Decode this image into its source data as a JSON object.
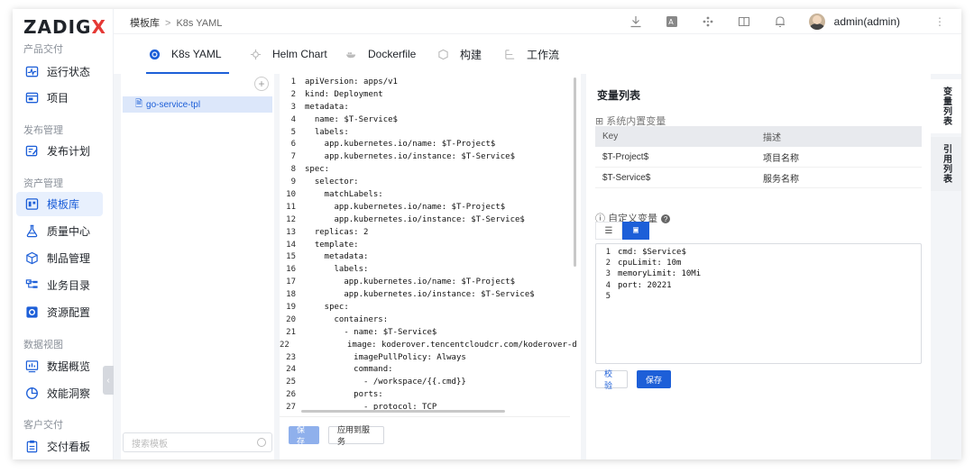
{
  "app": {
    "logo_text": "ZADIG",
    "logo_x": "X"
  },
  "breadcrumb": {
    "root": "模板库",
    "sep": ">",
    "current": "K8s YAML"
  },
  "user": {
    "name": "admin(admin)"
  },
  "sidebar": {
    "groups": [
      "产品交付",
      "发布管理",
      "资产管理",
      "数据视图",
      "客户交付"
    ],
    "items": [
      {
        "label": "运行状态",
        "icon": "pulse-icon"
      },
      {
        "label": "项目",
        "icon": "project-icon"
      },
      {
        "label": "发布计划",
        "icon": "plan-icon"
      },
      {
        "label": "模板库",
        "icon": "template-icon",
        "active": true
      },
      {
        "label": "质量中心",
        "icon": "flask-icon"
      },
      {
        "label": "制品管理",
        "icon": "package-icon"
      },
      {
        "label": "业务目录",
        "icon": "catalog-icon"
      },
      {
        "label": "资源配置",
        "icon": "gear-icon"
      },
      {
        "label": "数据概览",
        "icon": "chart-icon"
      },
      {
        "label": "效能洞察",
        "icon": "pie-icon"
      },
      {
        "label": "交付看板",
        "icon": "board-icon"
      }
    ]
  },
  "tabs": [
    {
      "label": "K8s YAML",
      "icon": "k8s-icon",
      "active": true
    },
    {
      "label": "Helm Chart",
      "icon": "helm-icon"
    },
    {
      "label": "Dockerfile",
      "icon": "docker-icon"
    },
    {
      "label": "构建",
      "icon": "build-icon"
    },
    {
      "label": "工作流",
      "icon": "workflow-icon"
    }
  ],
  "templates": {
    "items": [
      "go-service-tpl"
    ],
    "search_placeholder": "搜索模板"
  },
  "editor": {
    "lines": [
      "apiVersion: apps/v1",
      "kind: Deployment",
      "metadata:",
      "  name: $T-Service$",
      "  labels:",
      "    app.kubernetes.io/name: $T-Project$",
      "    app.kubernetes.io/instance: $T-Service$",
      "spec:",
      "  selector:",
      "    matchLabels:",
      "      app.kubernetes.io/name: $T-Project$",
      "      app.kubernetes.io/instance: $T-Service$",
      "  replicas: 2",
      "  template:",
      "    metadata:",
      "      labels:",
      "        app.kubernetes.io/name: $T-Project$",
      "        app.kubernetes.io/instance: $T-Service$",
      "    spec:",
      "      containers:",
      "        - name: $T-Service$",
      "          image: koderover.tencentcloudcr.com/koderover-demo",
      "          imagePullPolicy: Always",
      "          command:",
      "            - /workspace/{{.cmd}}",
      "          ports:",
      "            - protocol: TCP"
    ],
    "save_label": "保存",
    "apply_label": "应用到服务"
  },
  "variables": {
    "title": "变量列表",
    "system_label": "系统内置变量",
    "columns": [
      "Key",
      "描述"
    ],
    "rows": [
      {
        "key": "$T-Project$",
        "desc": "项目名称"
      },
      {
        "key": "$T-Service$",
        "desc": "服务名称"
      }
    ],
    "custom_label": "自定义变量",
    "custom_lines": [
      "cmd: $Service$",
      "cpuLimit: 10m",
      "memoryLimit: 10Mi",
      "port: 20221",
      ""
    ],
    "validate_label": "校验",
    "save_label": "保存"
  },
  "rail": {
    "tab1": "变量列表",
    "tab2": "引用列表"
  },
  "colors": {
    "accent": "#1d5fd8",
    "logo_x": "#e53935"
  }
}
